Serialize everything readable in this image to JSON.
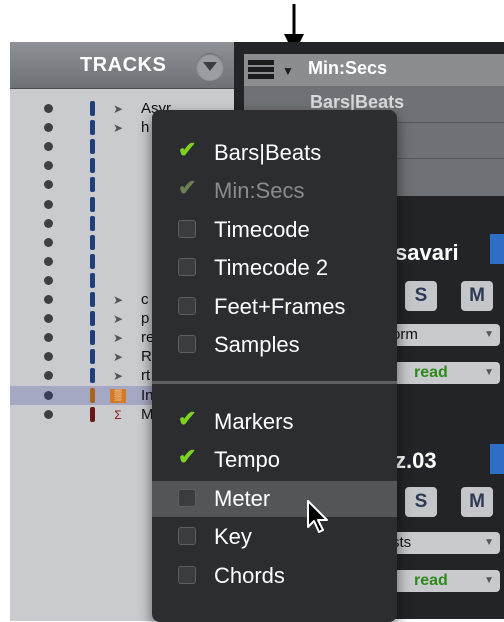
{
  "tracks_panel": {
    "title": "TRACKS",
    "rows": [
      {
        "name": "Asyr",
        "icon": "audio-icon",
        "color": "#1f3f7a",
        "selected": false
      },
      {
        "name": "h",
        "icon": "audio-icon",
        "color": "#1f3f7a",
        "selected": false
      },
      {
        "name": "",
        "icon": "",
        "color": "#1f3f7a",
        "selected": false
      },
      {
        "name": "",
        "icon": "",
        "color": "#1f3f7a",
        "selected": false
      },
      {
        "name": "",
        "icon": "",
        "color": "#1f3f7a",
        "selected": false
      },
      {
        "name": "",
        "icon": "",
        "color": "#1f3f7a",
        "selected": false
      },
      {
        "name": "",
        "icon": "",
        "color": "#1f3f7a",
        "selected": false
      },
      {
        "name": "",
        "icon": "",
        "color": "#1f3f7a",
        "selected": false
      },
      {
        "name": "",
        "icon": "",
        "color": "#1f3f7a",
        "selected": false
      },
      {
        "name": "",
        "icon": "",
        "color": "#1f3f7a",
        "selected": false
      },
      {
        "name": "c",
        "icon": "audio-icon",
        "color": "#1f3f7a",
        "selected": false
      },
      {
        "name": "p",
        "icon": "audio-icon",
        "color": "#1f3f7a",
        "selected": false
      },
      {
        "name": "re",
        "icon": "audio-icon",
        "color": "#1f3f7a",
        "selected": false
      },
      {
        "name": "R",
        "icon": "audio-icon",
        "color": "#1f3f7a",
        "selected": false
      },
      {
        "name": "rt",
        "icon": "audio-icon",
        "color": "#1f3f7a",
        "selected": false
      },
      {
        "name": "In",
        "icon": "instrument-icon",
        "color": "#a8641a",
        "selected": true
      },
      {
        "name": "M",
        "icon": "master-icon",
        "color": "#6b1515",
        "selected": false
      }
    ]
  },
  "ruler_header": {
    "active_ruler": "Min:Secs",
    "second_ruler": "Bars|Beats"
  },
  "mixer": {
    "strip1": {
      "name": "savari",
      "solo": "S",
      "mute": "M",
      "insert": "orm",
      "automation": "read"
    },
    "strip2": {
      "name": "z.03",
      "solo": "S",
      "mute": "M",
      "insert": "sts",
      "automation": "read"
    }
  },
  "menu": {
    "timebase_items": [
      {
        "label": "Bars|Beats",
        "checked": true,
        "dim": false
      },
      {
        "label": "Min:Secs",
        "checked": true,
        "dim": true
      },
      {
        "label": "Timecode",
        "checked": false,
        "dim": false
      },
      {
        "label": "Timecode 2",
        "checked": false,
        "dim": false
      },
      {
        "label": "Feet+Frames",
        "checked": false,
        "dim": false
      },
      {
        "label": "Samples",
        "checked": false,
        "dim": false
      }
    ],
    "conductor_items": [
      {
        "label": "Markers",
        "checked": true,
        "highlighted": false
      },
      {
        "label": "Tempo",
        "checked": true,
        "highlighted": false
      },
      {
        "label": "Meter",
        "checked": false,
        "highlighted": true
      },
      {
        "label": "Key",
        "checked": false,
        "highlighted": false
      },
      {
        "label": "Chords",
        "checked": false,
        "highlighted": false
      }
    ]
  },
  "colors": {
    "check": "#7ed321",
    "menu_bg": "#2c2d30",
    "highlight": "#545558"
  }
}
